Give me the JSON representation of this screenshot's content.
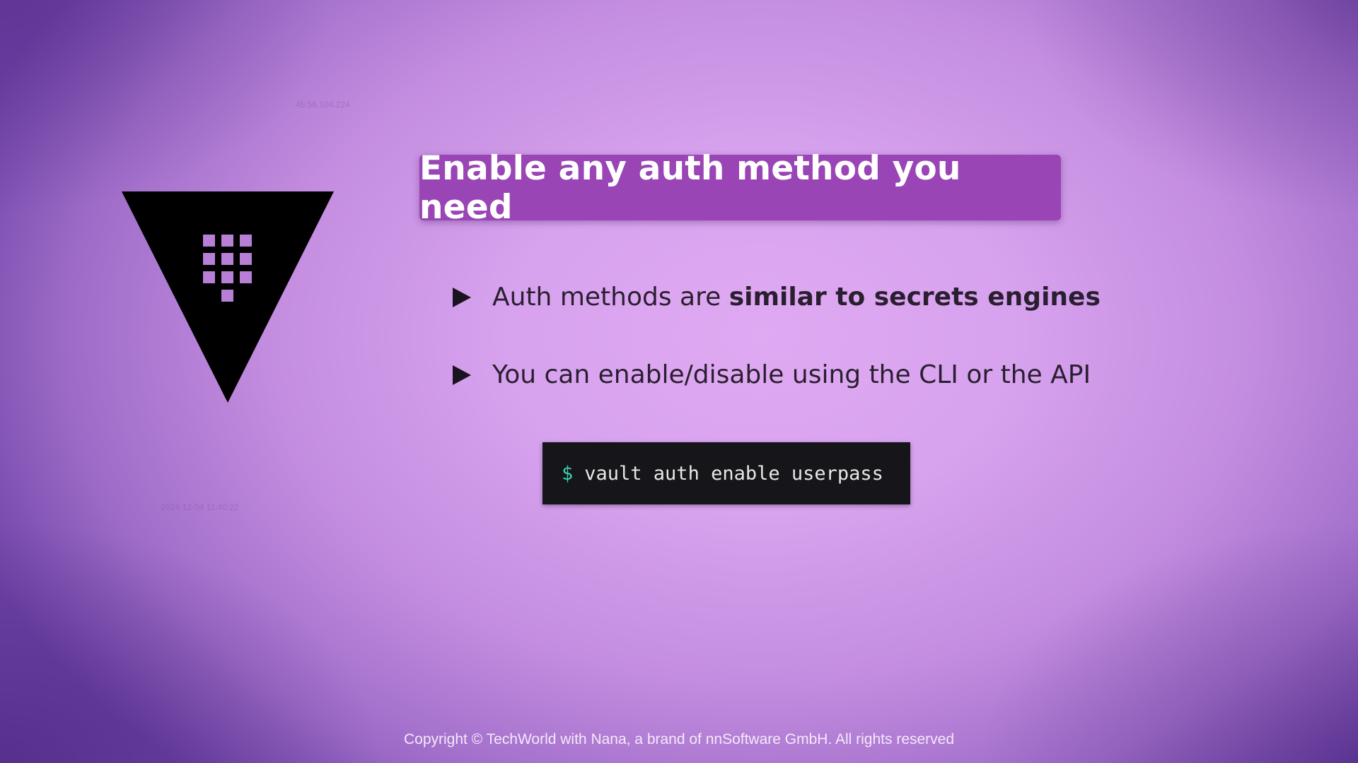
{
  "slide": {
    "title": "Enable any auth method you need",
    "bullets": [
      {
        "prefix": "Auth methods are ",
        "bold": "similar to secrets engines",
        "suffix": ""
      },
      {
        "prefix": "You can enable/disable using the CLI or the API",
        "bold": "",
        "suffix": ""
      }
    ],
    "terminal": {
      "prompt": "$",
      "command": "vault auth enable userpass"
    },
    "watermarks": {
      "ip": "45.56.104.224",
      "datetime": "2024-12-04 11:40:22"
    },
    "copyright": "Copyright © TechWorld with Nana, a brand of nnSoftware GmbH. All rights reserved"
  },
  "logo": {
    "icon": "vault-logo-icon"
  },
  "colors": {
    "banner": "#9a45b5",
    "banner_text": "#ffffff",
    "terminal_bg": "#15151a",
    "prompt": "#3ed0b0",
    "logo_triangle": "#000000",
    "logo_squares": "#b77fd6"
  }
}
